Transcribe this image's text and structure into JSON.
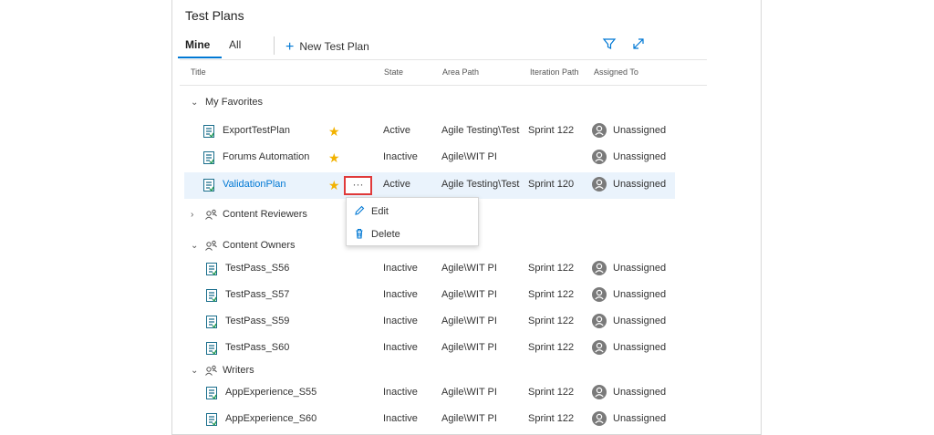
{
  "header": {
    "title": "Test Plans"
  },
  "tabs": [
    {
      "label": "Mine",
      "active": true
    },
    {
      "label": "All",
      "active": false
    }
  ],
  "toolbar": {
    "new_plan_label": "New Test Plan",
    "filter_icon": "filter-icon",
    "expand_icon": "expand-icon"
  },
  "columns": {
    "title": "Title",
    "state": "State",
    "area": "Area Path",
    "iteration": "Iteration Path",
    "assigned": "Assigned To"
  },
  "groups": {
    "favorites": "My Favorites",
    "reviewers": "Content Reviewers",
    "owners": "Content Owners",
    "writers": "Writers"
  },
  "favorites": [
    {
      "name": "ExportTestPlan",
      "state": "Active",
      "area": "Agile Testing\\Test",
      "iteration": "Sprint 122",
      "assigned": "Unassigned"
    },
    {
      "name": "Forums Automation",
      "state": "Inactive",
      "area": "Agile\\WIT PI",
      "iteration": "",
      "assigned": "Unassigned"
    },
    {
      "name": "ValidationPlan",
      "state": "Active",
      "area": "Agile Testing\\Test",
      "iteration": "Sprint 120",
      "assigned": "Unassigned"
    }
  ],
  "owners": [
    {
      "name": "TestPass_S56",
      "state": "Inactive",
      "area": "Agile\\WIT PI",
      "iteration": "Sprint 122",
      "assigned": "Unassigned"
    },
    {
      "name": "TestPass_S57",
      "state": "Inactive",
      "area": "Agile\\WIT PI",
      "iteration": "Sprint 122",
      "assigned": "Unassigned"
    },
    {
      "name": "TestPass_S59",
      "state": "Inactive",
      "area": "Agile\\WIT PI",
      "iteration": "Sprint 122",
      "assigned": "Unassigned"
    },
    {
      "name": "TestPass_S60",
      "state": "Inactive",
      "area": "Agile\\WIT PI",
      "iteration": "Sprint 122",
      "assigned": "Unassigned"
    }
  ],
  "writers": [
    {
      "name": "AppExperience_S55",
      "state": "Inactive",
      "area": "Agile\\WIT PI",
      "iteration": "Sprint 122",
      "assigned": "Unassigned"
    },
    {
      "name": "AppExperience_S60",
      "state": "Inactive",
      "area": "Agile\\WIT PI",
      "iteration": "Sprint 122",
      "assigned": "Unassigned"
    }
  ],
  "more_button": {
    "label": "···"
  },
  "context_menu": {
    "edit": "Edit",
    "delete": "Delete"
  },
  "colors": {
    "accent": "#0078d4",
    "star": "#f2b200",
    "highlight": "#e03a3a",
    "selected_row": "#eaf3fc"
  }
}
